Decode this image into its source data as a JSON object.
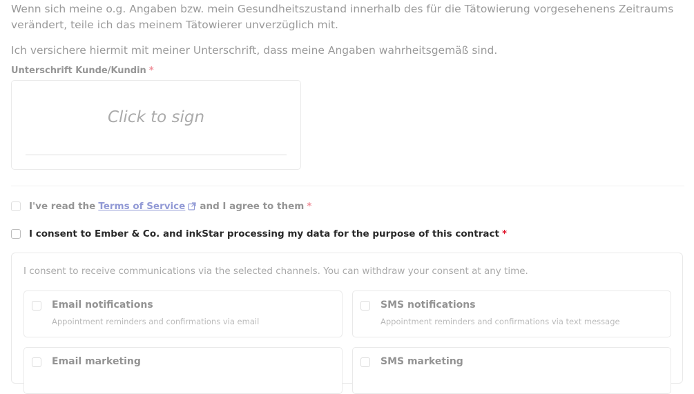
{
  "paragraphs": {
    "change_notice": "Wenn sich meine o.g. Angaben bzw. mein Gesundheitszustand innerhalb des für die Tätowierung vorgesehenens Zeitraums verändert, teile ich das meinem Tätowierer unverzüglich mit.",
    "assurance": "Ich versichere hiermit mit meiner Unterschrift, dass meine Angaben wahrheitsgemäß sind."
  },
  "signature": {
    "label": "Unterschrift Kunde/Kundin",
    "required_mark": "*",
    "placeholder": "Click to sign"
  },
  "terms": {
    "prefix": "I've read the",
    "link": "Terms of Service",
    "suffix": "and I agree to them",
    "required_mark": "*"
  },
  "consent": {
    "label": "I consent to Ember & Co. and inkStar processing my data for the purpose of this contract",
    "required_mark": "*"
  },
  "channels": {
    "intro": "I consent to receive communications via the selected channels. You can withdraw your consent at any time.",
    "options": [
      {
        "title": "Email notifications",
        "desc": "Appointment reminders and confirmations via email"
      },
      {
        "title": "SMS notifications",
        "desc": "Appointment reminders and confirmations via text message"
      },
      {
        "title": "Email marketing",
        "desc": ""
      },
      {
        "title": "SMS marketing",
        "desc": ""
      }
    ]
  },
  "colors": {
    "required": "#e0182d",
    "link": "#2233aa"
  }
}
